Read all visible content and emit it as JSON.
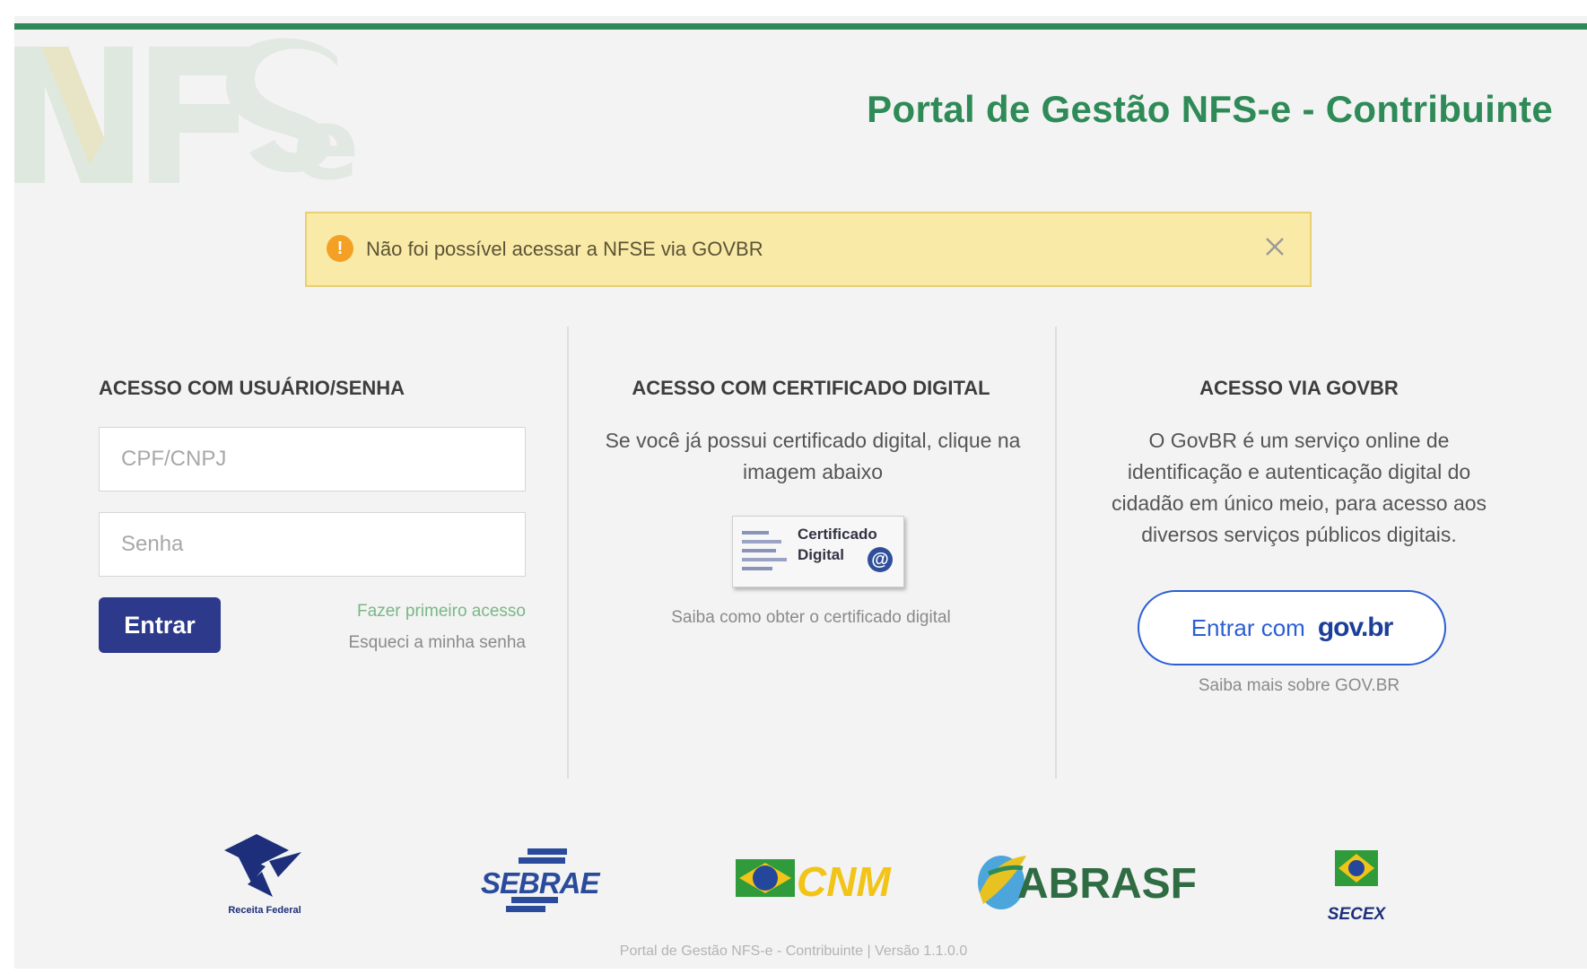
{
  "header": {
    "title": "Portal de Gestão NFS-e - Contribuinte",
    "watermark_logo": "NFSe"
  },
  "alert": {
    "icon": "!",
    "message": "Não foi possível acessar a NFSE via GOVBR",
    "color": "#faeaa7"
  },
  "login": {
    "heading": "ACESSO COM USUÁRIO/SENHA",
    "cpf_placeholder": "CPF/CNPJ",
    "password_placeholder": "Senha",
    "submit_label": "Entrar",
    "first_access_link": "Fazer primeiro acesso",
    "forgot_password_link": "Esqueci a minha senha"
  },
  "certificate": {
    "heading": "ACESSO COM CERTIFICADO DIGITAL",
    "description": "Se você já possui certificado digital, clique na imagem abaixo",
    "badge_line1": "Certificado",
    "badge_line2": "Digital",
    "badge_at": "@",
    "info_link": "Saiba como obter o certificado digital"
  },
  "govbr": {
    "heading": "ACESSO VIA GOVBR",
    "description": "O GovBR é um serviço online de identificação e autenticação digital do cidadão em único meio, para acesso aos diversos serviços públicos digitais.",
    "button_label": "Entrar com",
    "button_logo": "gov.br",
    "info_link": "Saiba mais sobre GOV.BR"
  },
  "sponsors": {
    "receita": "Receita Federal",
    "sebrae": "SEBRAE",
    "cnm": "CNM",
    "abrasf": "ABRASF",
    "secex": "SECEX"
  },
  "footer": {
    "text": "Portal de Gestão NFS-e - Contribuinte | Versão 1.1.0.0"
  },
  "colors": {
    "brand_green": "#2e8b57",
    "primary_button": "#2d3a8c",
    "govbr_blue": "#2c5fd3"
  }
}
